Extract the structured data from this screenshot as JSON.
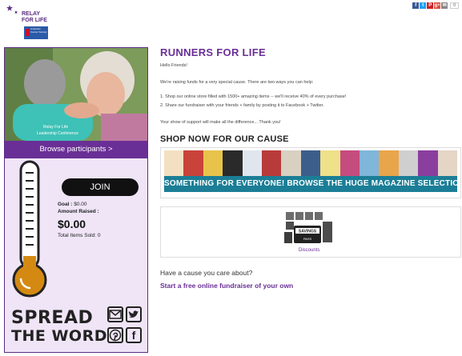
{
  "logo": {
    "line1": "RELAY",
    "line2": "FOR LIFE",
    "sponsor": "American Cancer Society"
  },
  "share": {
    "buttons": [
      "f",
      "t",
      "P",
      "g+",
      "✉"
    ],
    "count": "0"
  },
  "left": {
    "photo_caption": "Relay For Life",
    "photo_subcaption": "Leadership Conference",
    "browse": "Browse participants >",
    "join": "JOIN",
    "goal_label": "Goal : ",
    "goal_value": "$0.00",
    "raised_label": "Amount Raised :",
    "raised_value": "$0.00",
    "items_sold": "Total Items Sold: 0",
    "spread_line1": "SPREAD",
    "spread_line2": "THE WORD"
  },
  "main": {
    "title": "RUNNERS FOR LIFE",
    "greeting": "Hello Friends!",
    "intro": "We're raising funds for a very special cause. There are two ways you can help:",
    "way1": "1. Shop our online store filled with 1500+ amazing items -- we'll receive 40% of every purchase!",
    "way2": "2. Share our fundraiser with your friends + family by posting it to Facebook + Twitter.",
    "thanks": "Your show of support will make all the difference... Thank you!",
    "shop_heading": "SHOP NOW FOR OUR CAUSE",
    "banner_text": "SOMETHING FOR EVERYONE! BROWSE THE HUGE MAGAZINE SELECTION NOW >>",
    "discounts_label": "Discounts",
    "cause_question": "Have a cause you care about?",
    "cause_link": "Start a free online fundraiser of your own"
  }
}
